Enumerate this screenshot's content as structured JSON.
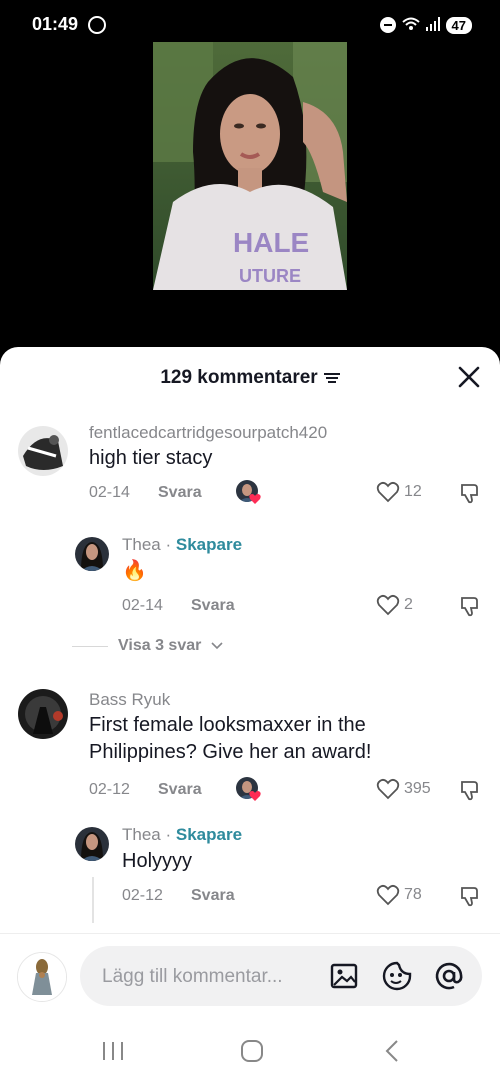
{
  "status_bar": {
    "time": "01:49",
    "battery": "47"
  },
  "sheet": {
    "comment_count": "129 kommentarer",
    "icons": {
      "filter": "filter-icon",
      "close": "close-icon"
    }
  },
  "comments": [
    {
      "username": "fentlacedcartridgesourpatch420",
      "text": "high tier stacy",
      "date": "02-14",
      "reply_label": "Svara",
      "likes": "12",
      "creator_liked": true
    },
    {
      "username": "Thea",
      "separator": "·",
      "creator_label": "Skapare",
      "text": "🔥",
      "date": "02-14",
      "reply_label": "Svara",
      "likes": "2"
    },
    {
      "username": "Bass Ryuk",
      "text_line1": "First female looksmaxxer in the",
      "text_line2": "Philippines? Give her an award!",
      "date": "02-12",
      "reply_label": "Svara",
      "likes": "395",
      "creator_liked": true
    },
    {
      "username": "Thea",
      "separator": "·",
      "creator_label": "Skapare",
      "text": "Holyyyy",
      "date": "02-12",
      "reply_label": "Svara",
      "likes": "78"
    }
  ],
  "view_replies": {
    "label": "Visa 3 svar",
    "icon": "chevron-down-icon"
  },
  "input": {
    "placeholder": "Lägg till kommentar...",
    "icons": [
      "image-icon",
      "sticker-icon",
      "mention-icon"
    ]
  },
  "colors": {
    "creator": "#2f8b9d",
    "meta_gray": "#86878b",
    "text": "#161823",
    "heart_badge": "#fe2c55"
  }
}
